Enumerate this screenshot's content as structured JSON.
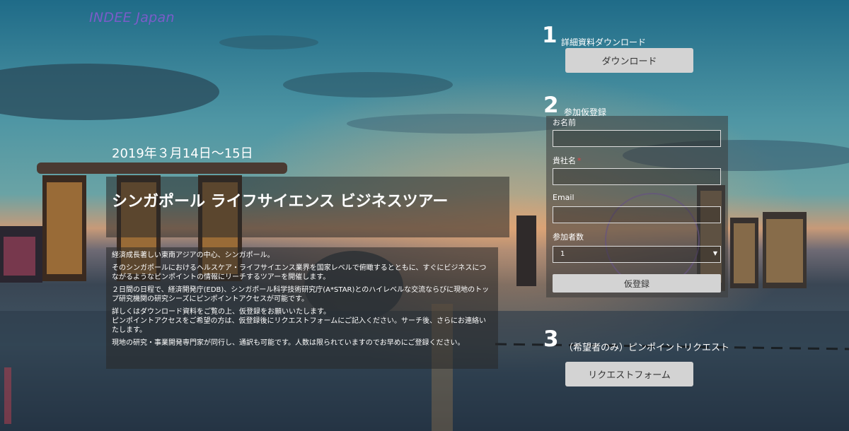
{
  "brand": {
    "logo_text": "INDEE Japan"
  },
  "event": {
    "date": "2019年３月14日～15日",
    "title": "シンガポール ライフサイエンス ビジネスツアー",
    "description": [
      "経済成長著しい東南アジアの中心、シンガポール。",
      "そのシンガポールにおけるヘルスケア・ライフサイエンス業界を国家レベルで俯瞰するとともに、すぐにビジネスにつながるようなピンポイントの情報にリーチするツアーを開催します。",
      "２日間の日程で、経済開発庁(EDB)、シンガポール科学技術研究庁(A*STAR)とのハイレベルな交流ならびに現地のトップ研究機関の研究シーズにピンポイントアクセスが可能です。",
      "詳しくはダウンロード資料をご覧の上、仮登録をお願いいたします。\nピンポイントアクセスをご希望の方は、仮登録後にリクエストフォームにご記入ください。サーチ後、さらにお連絡いたします。",
      "現地の研究・事業開発専門家が同行し、通訳も可能です。人数は限られていますのでお早めにご登録ください。"
    ]
  },
  "step1": {
    "number": "1",
    "label": "詳細資料ダウンロード",
    "button_label": "ダウンロード"
  },
  "step2": {
    "number": "2",
    "label": "参加仮登録",
    "form": {
      "name_label": "お名前",
      "name_value": "",
      "company_label": "貴社名",
      "company_required_mark": "*",
      "company_value": "",
      "email_label": "Email",
      "email_value": "",
      "participants_label": "参加者数",
      "participants_value": "1",
      "submit_label": "仮登録"
    }
  },
  "step3": {
    "number": "3",
    "label": "（希望者のみ）ピンポイントリクエスト",
    "button_label": "リクエストフォーム"
  },
  "icons": {
    "select_arrow": "▼"
  },
  "colors": {
    "logo": "#7b5cc9",
    "button": "#d3d3d3"
  }
}
